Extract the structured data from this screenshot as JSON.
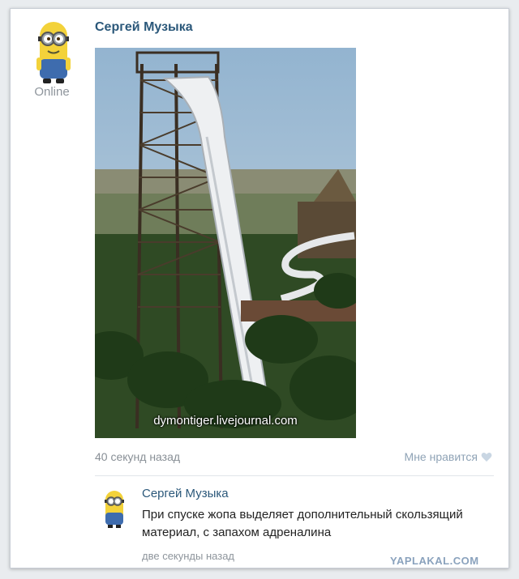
{
  "post": {
    "author": "Сергей Музыка",
    "status": "Online",
    "watermark": "dymontiger.livejournal.com",
    "time": "40 секунд назад",
    "like_label": "Мне нравится"
  },
  "comment": {
    "author": "Сергей Музыка",
    "text": "При спуске жопа выделяет дополнительный скользящий материал, с запахом адреналина",
    "time": "две секунды назад"
  },
  "site_watermark": "YAPLAKAL.COM",
  "icons": {
    "like": "heart-icon",
    "avatar": "minion-avatar"
  },
  "colors": {
    "author": "#2b587a",
    "like": "#8fa3b6",
    "heart": "#c9d6e3"
  }
}
